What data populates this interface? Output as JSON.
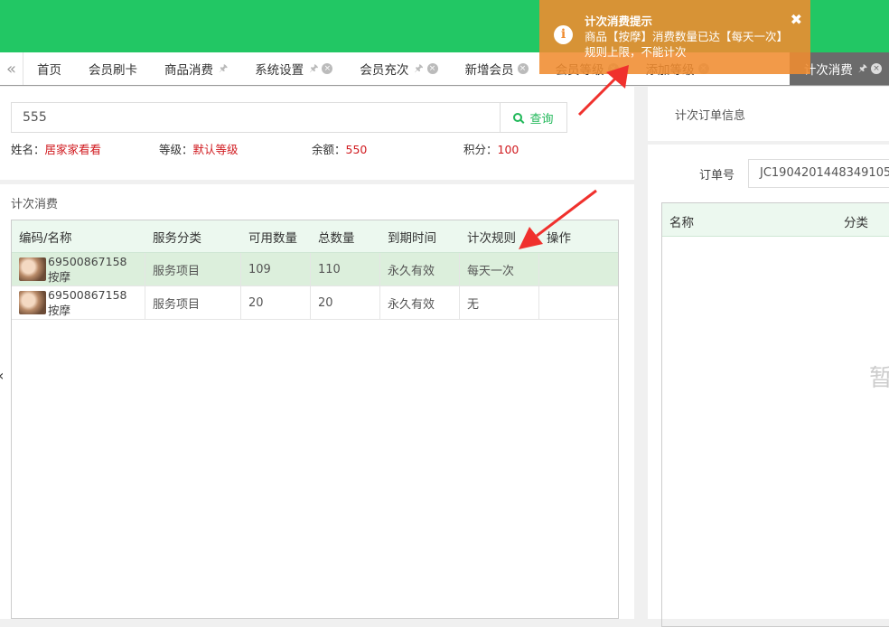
{
  "tabs": [
    {
      "label": "首页",
      "pin": false,
      "close": false
    },
    {
      "label": "会员刷卡",
      "pin": false,
      "close": false
    },
    {
      "label": "商品消费",
      "pin": true,
      "close": false
    },
    {
      "label": "系统设置",
      "pin": true,
      "close": true
    },
    {
      "label": "会员充次",
      "pin": true,
      "close": true
    },
    {
      "label": "新增会员",
      "pin": false,
      "close": true
    },
    {
      "label": "会员等级",
      "pin": false,
      "close": true
    },
    {
      "label": "添加等级",
      "pin": false,
      "close": true
    }
  ],
  "active_tab": {
    "label": "计次消费"
  },
  "search": {
    "value": "555",
    "button_label": "查询"
  },
  "member": {
    "name_label": "姓名：",
    "name": "居家家看看",
    "level_label": "等级：",
    "level": "默认等级",
    "balance_label": "余额：",
    "balance": "550",
    "points_label": "积分：",
    "points": "100"
  },
  "section_title": "计次消费",
  "table": {
    "headers": [
      "编码/名称",
      "服务分类",
      "可用数量",
      "总数量",
      "到期时间",
      "计次规则",
      "操作"
    ],
    "rows": [
      {
        "code": "69500867158",
        "name": "按摩",
        "category": "服务项目",
        "available": "109",
        "total": "110",
        "expiry": "永久有效",
        "rule": "每天一次"
      },
      {
        "code": "69500867158",
        "name": "按摩",
        "category": "服务项目",
        "available": "20",
        "total": "20",
        "expiry": "永久有效",
        "rule": "无"
      }
    ]
  },
  "right": {
    "title": "计次订单信息",
    "order_label": "订单号",
    "order_value": "JC1904201448349105",
    "headers": [
      "名称",
      "分类"
    ],
    "empty_text": "暂"
  },
  "toast": {
    "title": "计次消费提示",
    "message": "商品【按摩】消费数量已达【每天一次】规则上限，不能计次",
    "color": "#f08c30"
  },
  "colors": {
    "brand": "#22c764",
    "accent_text": "#d0191e",
    "selected_row": "#dcefdc",
    "arrow": "#f0312d"
  }
}
